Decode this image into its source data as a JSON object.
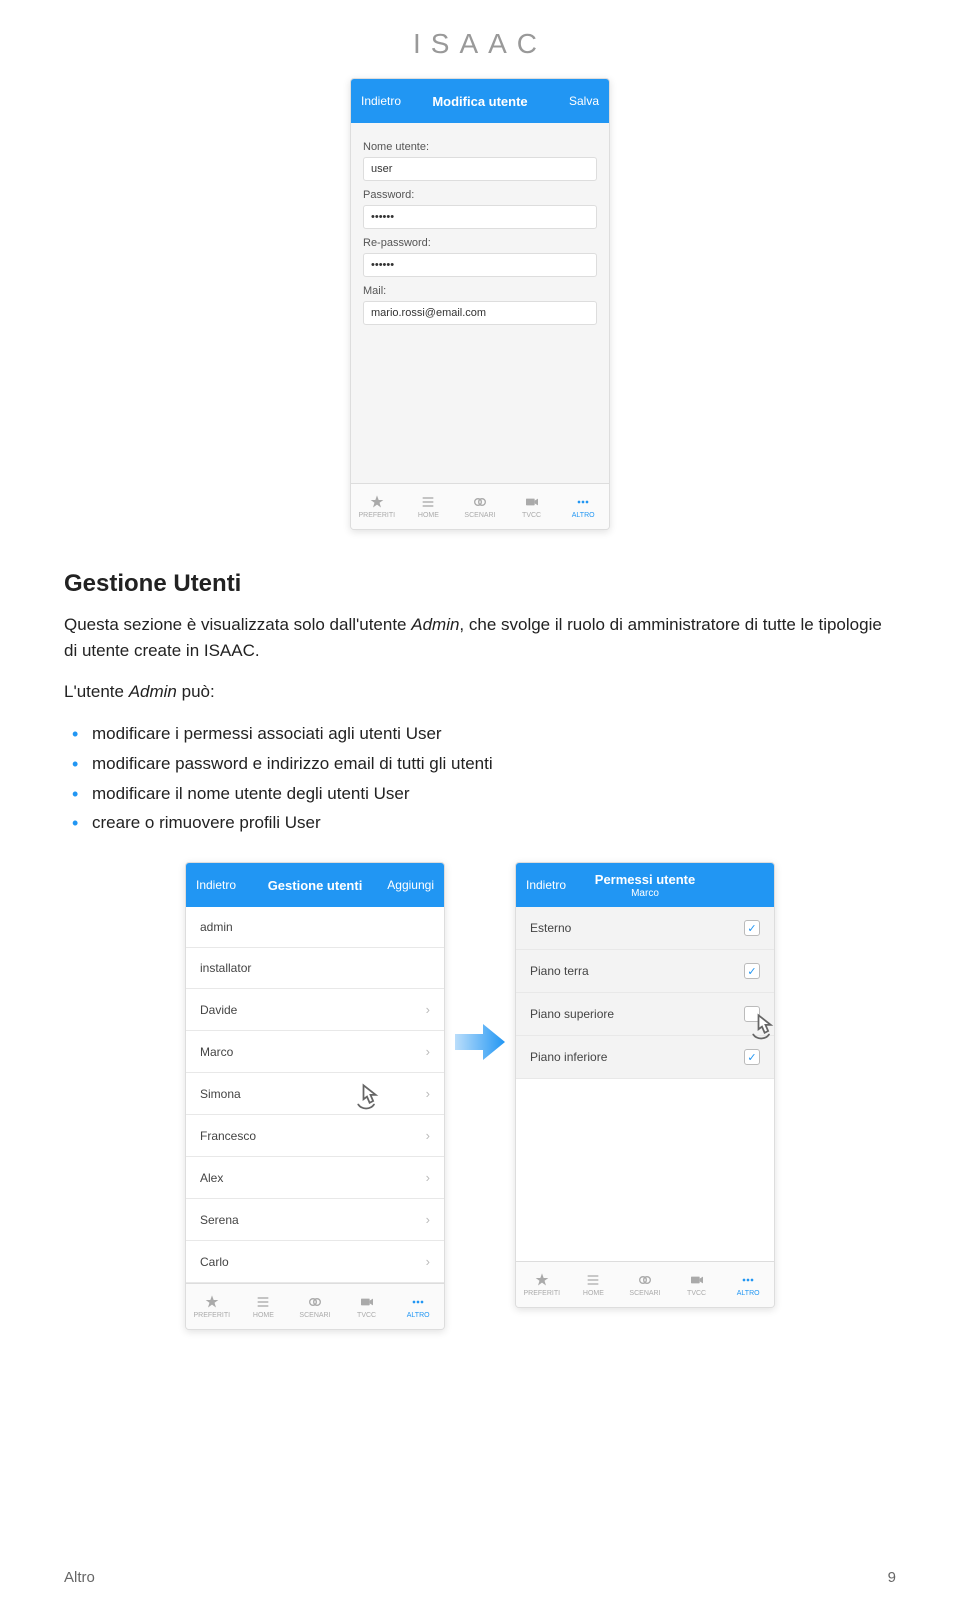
{
  "logo": "ISAAC",
  "screen1": {
    "nav_back": "Indietro",
    "nav_title": "Modifica utente",
    "nav_action": "Salva",
    "fields": {
      "username_label": "Nome utente:",
      "username_value": "user",
      "password_label": "Password:",
      "password_value": "••••••",
      "repassword_label": "Re-password:",
      "repassword_value": "••••••",
      "mail_label": "Mail:",
      "mail_value": "mario.rossi@email.com"
    }
  },
  "tabbar": {
    "t1": "PREFERITI",
    "t2": "HOME",
    "t3": "SCENARI",
    "t4": "TVCC",
    "t5": "ALTRO"
  },
  "section": {
    "heading": "Gestione Utenti",
    "intro_pre": "Questa sezione è visualizzata solo dall'utente ",
    "intro_admin": "Admin",
    "intro_mid": ", che svolge il ruolo di amministratore di tutte le tipologie di utente create in ISAAC.",
    "lead_pre": "L'utente ",
    "lead_admin": "Admin",
    "lead_post": " può:",
    "b1_pre": "modificare i permessi associati agli utenti ",
    "b1_it": "User",
    "b2": "modificare password e indirizzo email di tutti gli utenti",
    "b3_pre": "modificare il nome utente degli utenti ",
    "b3_it": "User",
    "b4_pre": "creare o rimuovere profili ",
    "b4_it": "User"
  },
  "screen2": {
    "nav_back": "Indietro",
    "nav_title": "Gestione utenti",
    "nav_action": "Aggiungi",
    "items": [
      "admin",
      "installator",
      "Davide",
      "Marco",
      "Simona",
      "Francesco",
      "Alex",
      "Serena",
      "Carlo"
    ]
  },
  "screen3": {
    "nav_back": "Indietro",
    "nav_title": "Permessi utente",
    "nav_subtitle": "Marco",
    "perms": [
      {
        "label": "Esterno",
        "checked": true
      },
      {
        "label": "Piano terra",
        "checked": true
      },
      {
        "label": "Piano superiore",
        "checked": false
      },
      {
        "label": "Piano inferiore",
        "checked": true
      }
    ]
  },
  "footer": {
    "left": "Altro",
    "right": "9"
  }
}
